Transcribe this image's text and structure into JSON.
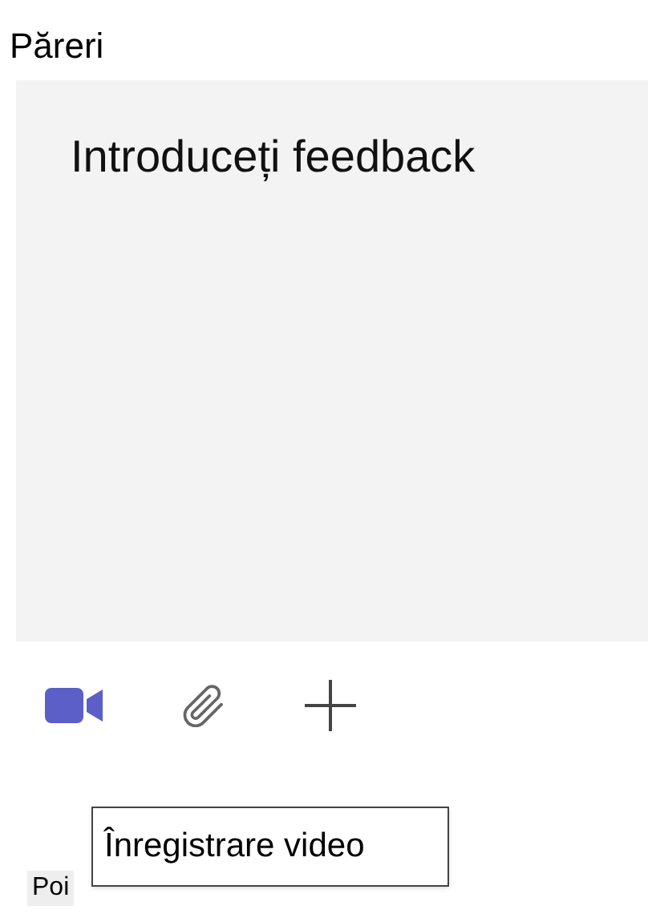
{
  "field_label": "Păreri",
  "feedback_field": {
    "placeholder": "Introduceți feedback"
  },
  "toolbar": [
    {
      "kind": "video"
    },
    {
      "kind": "attach"
    },
    {
      "kind": "add"
    }
  ],
  "tooltip": "Înregistrare video",
  "bottom_label": "Poi"
}
